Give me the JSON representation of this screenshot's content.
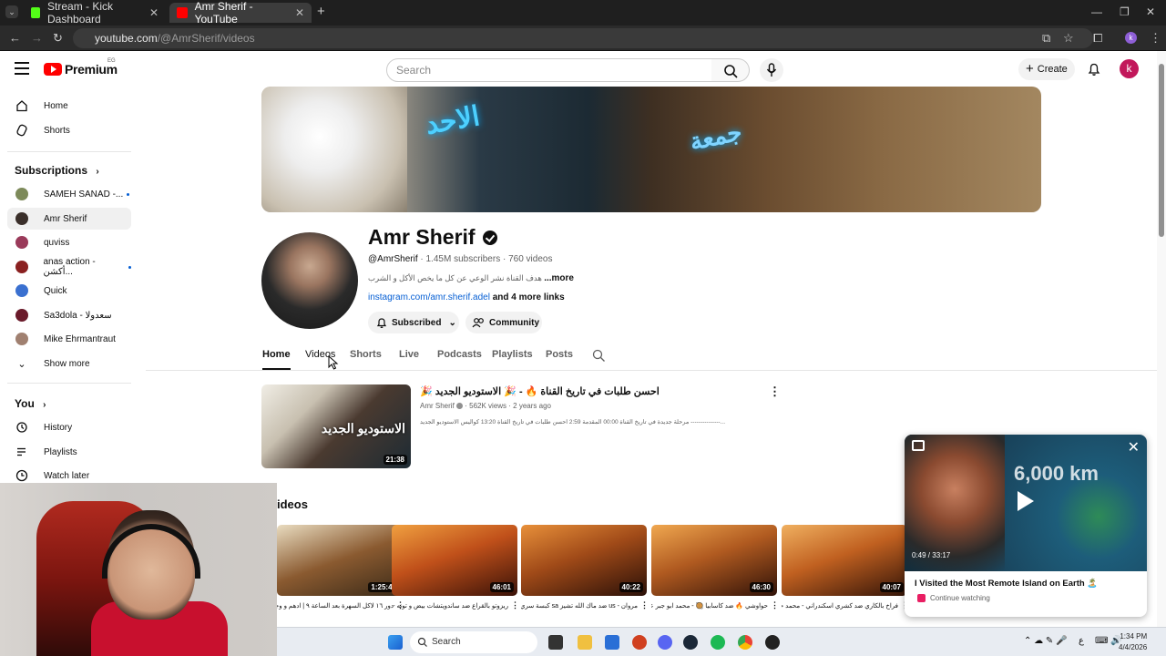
{
  "browser": {
    "tabs": [
      {
        "title": "Stream - Kick Dashboard",
        "active": false,
        "favicon_color": "#53fc18"
      },
      {
        "title": "Amr Sherif - YouTube",
        "active": true,
        "favicon_color": "#ff0000"
      }
    ],
    "url_host": "youtube.com",
    "url_path": "/@AmrSherif/videos"
  },
  "header": {
    "logo_text": "Premium",
    "country_code": "EG",
    "search_placeholder": "Search",
    "create_label": "Create",
    "avatar_letter": "k"
  },
  "sidebar": {
    "main": [
      {
        "label": "Home",
        "icon": "home-icon"
      },
      {
        "label": "Shorts",
        "icon": "shorts-icon"
      }
    ],
    "subscriptions_label": "Subscriptions",
    "subscriptions": [
      {
        "label": "SAMEH SANAD -...",
        "color": "#7d8a5a",
        "live_dot": true
      },
      {
        "label": "Amr Sherif",
        "color": "#3a2f2a",
        "live_dot": false,
        "active": true
      },
      {
        "label": "quviss",
        "color": "#9a3a5a",
        "live_dot": false
      },
      {
        "label": "anas action - أكشن...",
        "color": "#8a2020",
        "live_dot": true
      },
      {
        "label": "Quick",
        "color": "#3a70d0",
        "live_dot": false
      },
      {
        "label": "Sa3dola - سعدولا",
        "color": "#6a1a2a",
        "live_dot": false
      },
      {
        "label": "Mike Ehrmantraut",
        "color": "#a08070",
        "live_dot": false
      }
    ],
    "show_more": "Show more",
    "you_label": "You",
    "you_items": [
      {
        "label": "History",
        "icon": "history-icon"
      },
      {
        "label": "Playlists",
        "icon": "playlists-icon"
      },
      {
        "label": "Watch later",
        "icon": "watch-later-icon"
      }
    ]
  },
  "channel": {
    "name": "Amr Sherif",
    "handle": "@AmrSherif",
    "subscribers": "1.45M subscribers",
    "videos_count": "760 videos",
    "description": "هدف القناة نشر الوعي عن كل ما يخص الأكل و الشرب",
    "more_label": "...more",
    "link": "instagram.com/amr.sherif.adel",
    "more_links": "and 4 more links",
    "subscribed_label": "Subscribed",
    "community_label": "Community"
  },
  "channel_tabs": [
    "Home",
    "Videos",
    "Shorts",
    "Live",
    "Podcasts",
    "Playlists",
    "Posts"
  ],
  "featured": {
    "title": "🎉 احسن طلبات في تاريخ القناة 🔥 - 🎉 الاستوديو الجديد",
    "channel": "Amr Sherif",
    "views": "562K views",
    "age": "2 years ago",
    "description": "مرحلة جديدة في تاريخ القناة 00:00 المقدمة 2:59 احسن طلبات في تاريخ القناة 13:20 كواليس الاستوديو الجديد ---------------...",
    "duration": "21:38",
    "thumb_text": "الاستوديو الجديد"
  },
  "videos_heading": "ideos",
  "videos": [
    {
      "title": "دور ١٦ لاكل السهرة بعد الساعة ٩ | ادهم و وجدي لازم...",
      "duration": "1:25:49",
      "tint": "#8a5a30"
    },
    {
      "title": "ريزوتو بالقراع ضد ساندويتشات بيض و تونه - احمد الوكيل 🏮 - البوكس...",
      "duration": "46:01",
      "tint": "#c0501a"
    },
    {
      "title": "مروان - us ضد ماك الله تشيز sa كبسة سري 🏮 - البوكس الغامض 👀 (٢)",
      "duration": "40:22",
      "tint": "#a04a18"
    },
    {
      "title": "حواوشي 🔥 ضد كاسابيا 🥘 - محمد ابو جبر عي 🏮 - البوكس الغامض 👀 (٦)",
      "duration": "46:30",
      "tint": "#b05a20"
    },
    {
      "title": "فراخ بالكاري ضد كشري اسكندراني - محمد حازم 🏮 - البوكس الغامض 👀",
      "duration": "40:07",
      "tint": "#c06020"
    }
  ],
  "miniplayer": {
    "title": "I Visited the Most Remote Island on Earth 🏝️",
    "time": "0:49 / 33:17",
    "distance_text": "6,000 km",
    "continue_label": "Continue watching"
  },
  "taskbar": {
    "search_label": "Search",
    "time": "1:34 PM",
    "date": "4/4/2026",
    "lang": "ع"
  }
}
